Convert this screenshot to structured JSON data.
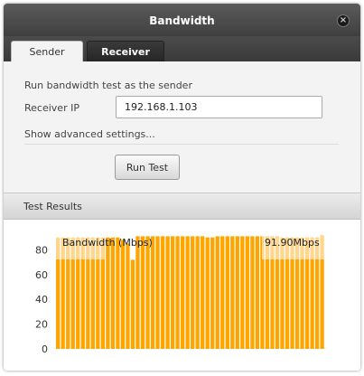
{
  "window": {
    "title": "Bandwidth"
  },
  "tabs": [
    {
      "label": "Sender",
      "active": true
    },
    {
      "label": "Receiver",
      "active": false
    }
  ],
  "form": {
    "description": "Run bandwidth test as the sender",
    "receiver_ip_label": "Receiver IP",
    "receiver_ip_value": "192.168.1.103",
    "advanced_link": "Show advanced settings...",
    "run_button": "Run Test"
  },
  "results": {
    "header": "Test Results",
    "chart_label": "Bandwidth (Mbps)",
    "current_value": "91.90Mbps"
  },
  "colors": {
    "bar": "#ffa500",
    "bar_top": "#ffd68a",
    "title_bar": "#4a4a4a"
  },
  "chart_data": {
    "type": "bar",
    "title": "Bandwidth (Mbps)",
    "ylabel": "",
    "xlabel": "",
    "ylim": [
      0,
      92
    ],
    "yticks": [
      0,
      20,
      40,
      60,
      80
    ],
    "grid": false,
    "series": [
      {
        "values": [
          90,
          90,
          90,
          90,
          90,
          90,
          90,
          90,
          90,
          90,
          90,
          90,
          90,
          88,
          85,
          72,
          91,
          91,
          91,
          91,
          91,
          91,
          91,
          91,
          91,
          91,
          91,
          91,
          91,
          91,
          90,
          90,
          91,
          91,
          91,
          91,
          91,
          91,
          91,
          91,
          91,
          91,
          91,
          91,
          91,
          90,
          90,
          90,
          90,
          90,
          90,
          90,
          90,
          91.9
        ]
      }
    ]
  }
}
